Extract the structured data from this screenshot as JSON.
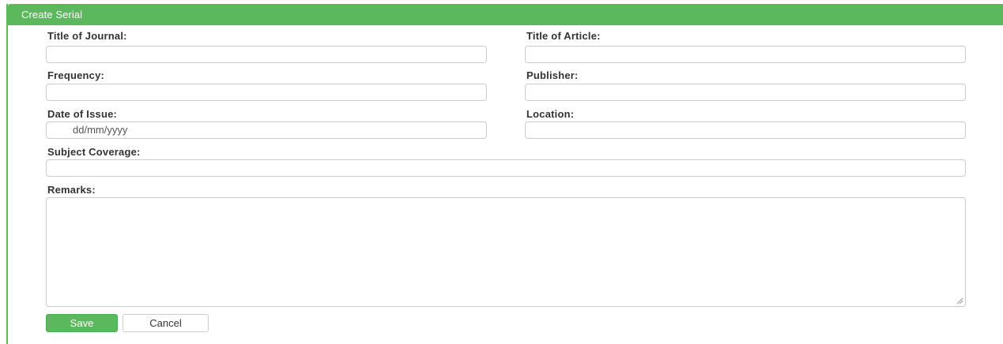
{
  "panel": {
    "title": "Create Serial",
    "accent_color": "#5cb85c"
  },
  "form": {
    "title_of_journal": {
      "label": "Title of Journal:",
      "value": ""
    },
    "title_of_article": {
      "label": "Title of Article:",
      "value": ""
    },
    "frequency": {
      "label": "Frequency:",
      "value": ""
    },
    "publisher": {
      "label": "Publisher:",
      "value": ""
    },
    "date_of_issue": {
      "label": "Date of Issue:",
      "value": "",
      "placeholder": "dd/mm/yyyy"
    },
    "location": {
      "label": "Location:",
      "value": ""
    },
    "subject_coverage": {
      "label": "Subject Coverage:",
      "value": ""
    },
    "remarks": {
      "label": "Remarks:",
      "value": ""
    }
  },
  "actions": {
    "save_label": "Save",
    "cancel_label": "Cancel"
  }
}
